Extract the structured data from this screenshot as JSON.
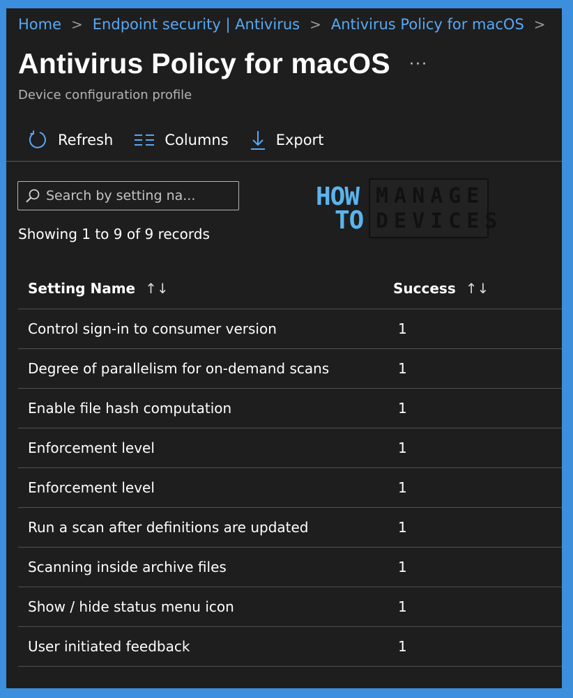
{
  "breadcrumb": [
    "Home",
    "Endpoint security | Antivirus",
    "Antivirus Policy for macOS"
  ],
  "page": {
    "title": "Antivirus Policy for macOS",
    "more_label": "···",
    "subtitle": "Device configuration profile"
  },
  "toolbar": {
    "refresh_label": "Refresh",
    "columns_label": "Columns",
    "export_label": "Export"
  },
  "search": {
    "placeholder": "Search by setting na..."
  },
  "logo": {
    "how": "HOW",
    "to": "TO",
    "manage": "MANAGE",
    "devices": "DEVICES"
  },
  "records_text": "Showing 1 to 9 of 9 records",
  "table": {
    "columns": [
      "Setting Name",
      "Success"
    ],
    "sort_icon": "↑↓",
    "rows": [
      {
        "name": "Control sign-in to consumer version",
        "success": "1"
      },
      {
        "name": "Degree of parallelism for on-demand scans",
        "success": "1"
      },
      {
        "name": "Enable file hash computation",
        "success": "1"
      },
      {
        "name": "Enforcement level",
        "success": "1"
      },
      {
        "name": "Enforcement level",
        "success": "1"
      },
      {
        "name": "Run a scan after definitions are updated",
        "success": "1"
      },
      {
        "name": "Scanning inside archive files",
        "success": "1"
      },
      {
        "name": "Show / hide status menu icon",
        "success": "1"
      },
      {
        "name": "User initiated feedback",
        "success": "1"
      }
    ]
  },
  "colors": {
    "link": "#57a9f5",
    "background": "#1e1e1e",
    "frame": "#3b8fdc"
  }
}
